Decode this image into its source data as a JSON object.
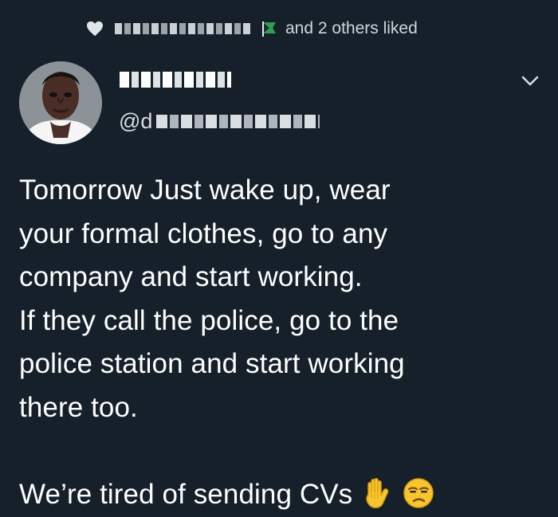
{
  "social_context": {
    "liked_text": "and 2 others liked",
    "icons": {
      "like": "heart-icon",
      "flag": "flag-icon"
    }
  },
  "author": {
    "handle_prefix": "@d",
    "avatar": "avatar"
  },
  "tweet": {
    "lines": [
      "Tomorrow Just wake up, wear",
      "your formal clothes, go to any",
      "company and start working.",
      "If they call the police, go to the",
      "police station and start working",
      "there too."
    ],
    "final_line": "We’re tired of sending CVs"
  },
  "icons": {
    "more": "chevron-down-icon",
    "raised_hand": "raised-hand-icon",
    "unamused_face": "unamused-face-icon"
  },
  "colors": {
    "background": "#15202b",
    "text": "#ffffff",
    "secondary_text": "#cfd6dc",
    "emoji_yellow": "#f8c52c"
  }
}
